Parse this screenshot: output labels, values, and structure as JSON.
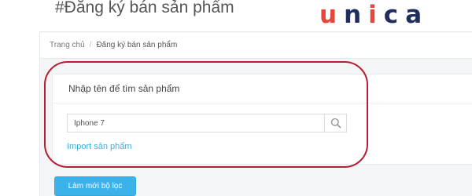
{
  "page_title": "#Đăng ký bán sản phẩm",
  "brand": {
    "letters": [
      {
        "char": "u",
        "color": "#e8463c"
      },
      {
        "char": "n",
        "color": "#1f2e5c"
      },
      {
        "char": "i",
        "color": "#e8463c"
      },
      {
        "char": "c",
        "color": "#1f2e5c"
      },
      {
        "char": "a",
        "color": "#1f2e5c"
      }
    ]
  },
  "breadcrumb": {
    "home": "Trang chủ",
    "separator": "/",
    "current": "Đăng ký bán sản phẩm"
  },
  "search_card": {
    "title": "Nhập tên để tìm sản phẩm",
    "input_value": "Iphone 7",
    "search_icon": "search-icon",
    "import_link": "Import sản phẩm"
  },
  "reset_button_label": "Làm mới bộ lọc",
  "colors": {
    "accent_blue": "#3cb2ea",
    "link_blue": "#3eb1d8",
    "highlight_red": "#b51f33",
    "brand_red": "#e8463c",
    "brand_navy": "#1f2e5c"
  }
}
